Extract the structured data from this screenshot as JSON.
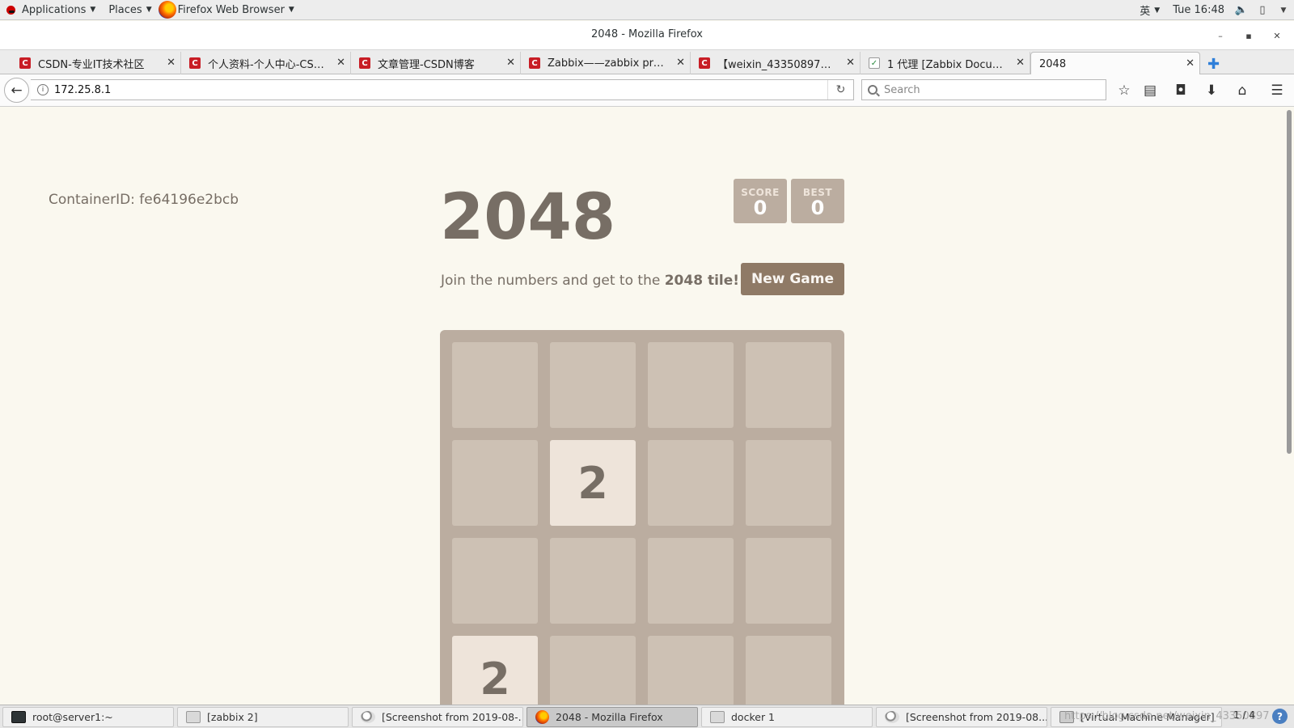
{
  "top_panel": {
    "applications": "Applications",
    "places": "Places",
    "active_app": "Firefox Web Browser",
    "input_method": "英",
    "clock": "Tue 16:48"
  },
  "window": {
    "title": "2048 - Mozilla Firefox"
  },
  "tabs": [
    {
      "label": "CSDN-专业IT技术社区"
    },
    {
      "label": "个人资料-个人中心-CSDN"
    },
    {
      "label": "文章管理-CSDN博客"
    },
    {
      "label": "Zabbix——zabbix proxy..."
    },
    {
      "label": "【weixin_43350897的..."
    },
    {
      "label": "1 代理 [Zabbix Documen..."
    },
    {
      "label": "2048"
    }
  ],
  "navbar": {
    "url": "172.25.8.1",
    "search_placeholder": "Search"
  },
  "page": {
    "container_id": "ContainerID: fe64196e2bcb",
    "title": "2048",
    "score_label": "SCORE",
    "score_value": "0",
    "best_label": "BEST",
    "best_value": "0",
    "intro_text": "Join the numbers and get to the ",
    "intro_bold": "2048 tile!",
    "new_game_label": "New Game"
  },
  "board": {
    "rows": [
      [
        "",
        "",
        "",
        ""
      ],
      [
        "",
        "2",
        "",
        ""
      ],
      [
        "",
        "",
        "",
        ""
      ],
      [
        "2",
        "",
        "",
        ""
      ]
    ]
  },
  "taskbar": {
    "items": [
      {
        "label": "root@server1:~",
        "icon": "terminal-icon"
      },
      {
        "label": "[zabbix 2]",
        "icon": "window-icon"
      },
      {
        "label": "[Screenshot from 2019-08-...",
        "icon": "screenshot-icon"
      },
      {
        "label": "2048 - Mozilla Firefox",
        "icon": "firefox-icon"
      },
      {
        "label": "docker 1",
        "icon": "window-icon"
      },
      {
        "label": "[Screenshot from 2019-08...",
        "icon": "screenshot-icon"
      },
      {
        "label": "[Virtual Machine Manager]",
        "icon": "vm-manager-icon"
      }
    ],
    "workspace": "1 / 4",
    "watermark": "https://blog.csdn.net/weixin_43350897"
  },
  "colors": {
    "page_bg": "#faf8ef",
    "board_bg": "#bbada0",
    "empty_cell": "#cdc1b4",
    "tile_2": "#eee4da",
    "text_brown": "#776e65",
    "button_brown": "#8f7a66"
  }
}
